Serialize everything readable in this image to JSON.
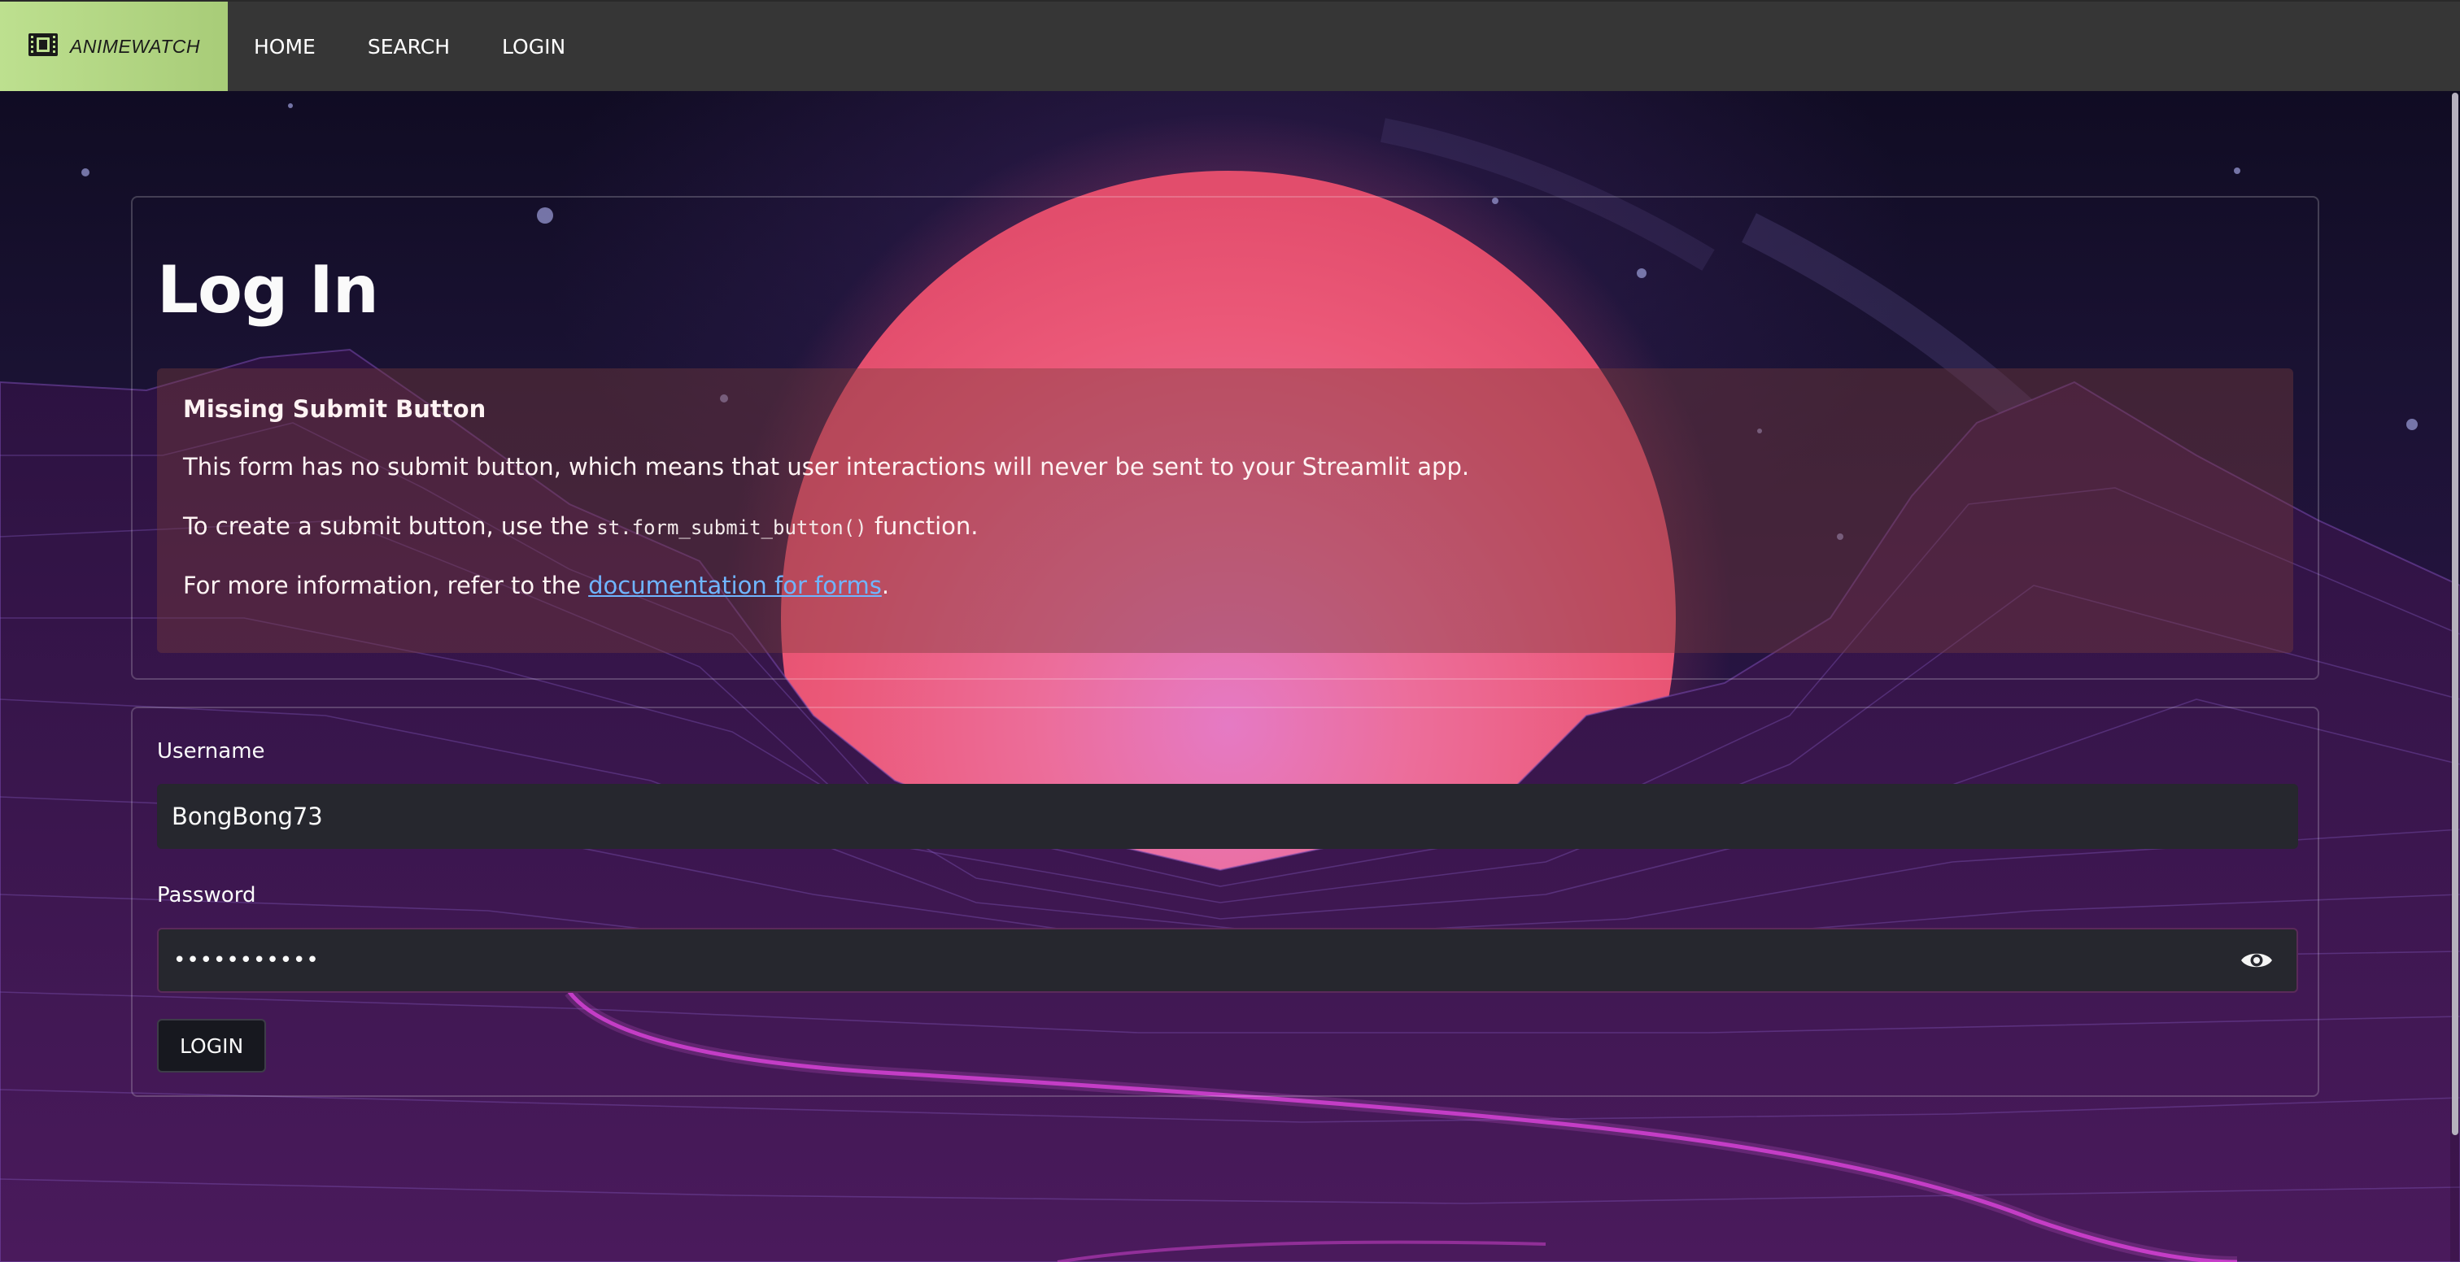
{
  "app": {
    "brand": "ANIMEWATCH",
    "brand_icon": "film-icon"
  },
  "nav": {
    "items": [
      {
        "label": "HOME"
      },
      {
        "label": "SEARCH"
      },
      {
        "label": "LOGIN"
      }
    ]
  },
  "main": {
    "title": "Log In",
    "warning": {
      "title": "Missing Submit Button",
      "line1": "This form has no submit button, which means that user interactions will never be sent to your Streamlit app.",
      "line2_before": "To create a submit button, use the ",
      "line2_code": "st.form_submit_button()",
      "line2_after": " function.",
      "line3_before": "For more information, refer to the ",
      "line3_link": "documentation for forms",
      "line3_after": "."
    },
    "form": {
      "username_label": "Username",
      "username_value": "BongBong73",
      "password_label": "Password",
      "password_value": "•••••••••••",
      "password_toggle_icon": "eye-icon",
      "login_button": "LOGIN"
    }
  },
  "colors": {
    "navbar_bg": "#363636",
    "brand_bg": "#bde08f",
    "sun": "#ea5a79",
    "warning_bg": "#783c3c",
    "link": "#6fb5ff",
    "input_bg": "#26272e"
  }
}
